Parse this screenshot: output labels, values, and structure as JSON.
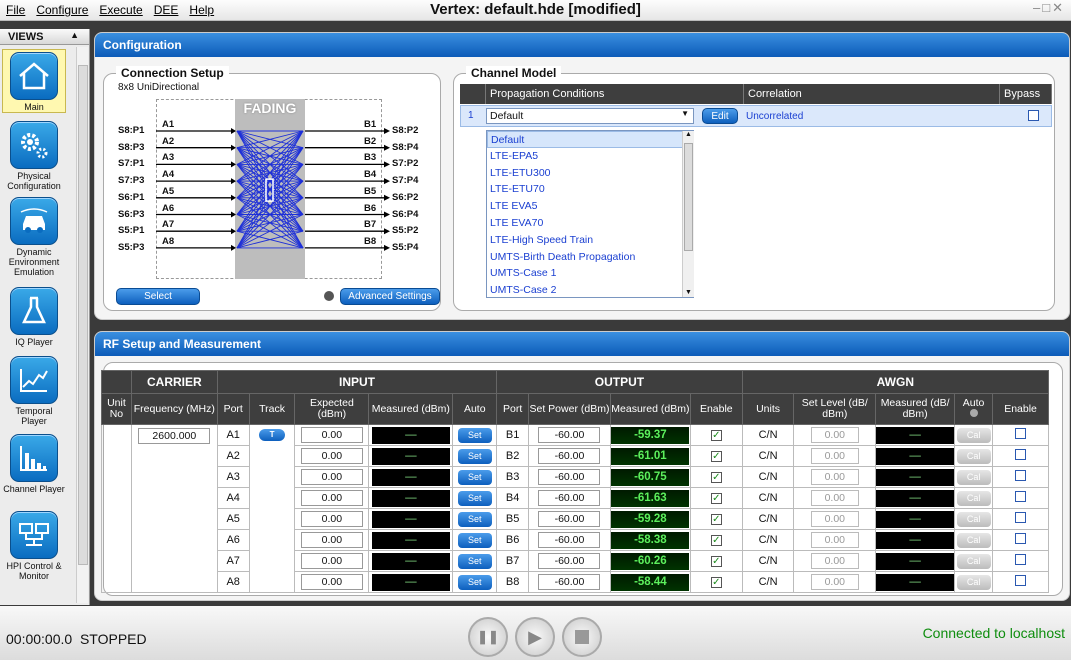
{
  "window": {
    "title": "Vertex: default.hde  [modified]",
    "menu": [
      "File",
      "Configure",
      "Execute",
      "DEE",
      "Help"
    ],
    "controls": "–□✕"
  },
  "sidebar": {
    "header": "VIEWS",
    "items": [
      {
        "label": "Main",
        "icon": "home-icon",
        "active": true
      },
      {
        "label": "Physical Configuration",
        "icon": "gears-icon"
      },
      {
        "label": "Dynamic Environment Emulation",
        "icon": "car-icon"
      },
      {
        "label": "IQ Player",
        "icon": "flask-icon"
      },
      {
        "label": "Temporal Player",
        "icon": "graph-icon"
      },
      {
        "label": "Channel Player",
        "icon": "bars-icon"
      },
      {
        "label": "HPI Control & Monitor",
        "icon": "network-icon"
      }
    ]
  },
  "configuration": {
    "title": "Configuration",
    "connection_setup": {
      "title": "Connection Setup",
      "mode": "8x8 UniDirectional",
      "fading_label": "FADING",
      "left_ports": [
        "S8:P1",
        "S8:P3",
        "S7:P1",
        "S7:P3",
        "S6:P1",
        "S6:P3",
        "S5:P1",
        "S5:P3"
      ],
      "inputs": [
        "A1",
        "A2",
        "A3",
        "A4",
        "A5",
        "A6",
        "A7",
        "A8"
      ],
      "outputs": [
        "B1",
        "B2",
        "B3",
        "B4",
        "B5",
        "B6",
        "B7",
        "B8"
      ],
      "right_ports": [
        "S8:P2",
        "S8:P4",
        "S7:P2",
        "S7:P4",
        "S6:P2",
        "S6:P4",
        "S5:P2",
        "S5:P4"
      ],
      "select_label": "Select",
      "advanced_label": "Advanced Settings"
    },
    "channel_model": {
      "title": "Channel Model",
      "headers": {
        "propagation": "Propagation Conditions",
        "correlation": "Correlation",
        "bypass": "Bypass"
      },
      "row": {
        "index": "1",
        "propagation": "Default",
        "edit_label": "Edit",
        "correlation": "Uncorrelated"
      },
      "dropdown_options": [
        "Default",
        "LTE-EPA5",
        "LTE-ETU300",
        "LTE-ETU70",
        "LTE EVA5",
        "LTE EVA70",
        "LTE-High Speed Train",
        "UMTS-Birth Death Propagation",
        "UMTS-Case 1",
        "UMTS-Case 2"
      ]
    }
  },
  "rf": {
    "title": "RF Setup and Measurement",
    "groups": {
      "carrier": "CARRIER",
      "input": "INPUT",
      "output": "OUTPUT",
      "awgn": "AWGN"
    },
    "headers": {
      "unit": "Unit No",
      "frequency": "Frequency (MHz)",
      "port": "Port",
      "track": "Track",
      "expected": "Expected (dBm)",
      "measured": "Measured (dBm)",
      "auto": "Auto",
      "set_power": "Set Power (dBm)",
      "enable": "Enable",
      "units": "Units",
      "set_level": "Set Level (dB/ dBm)",
      "measured_awgn": "Measured (dB/ dBm)"
    },
    "frequency": "2600.000",
    "track_label": "T",
    "set_label": "Set",
    "cal_label": "Cal",
    "rows": [
      {
        "in_port": "A1",
        "expected": "0.00",
        "in_meas": "—",
        "out_port": "B1",
        "set_power": "-60.00",
        "out_meas": "-59.37",
        "units": "C/N",
        "level": "0.00",
        "awgn_meas": "—"
      },
      {
        "in_port": "A2",
        "expected": "0.00",
        "in_meas": "—",
        "out_port": "B2",
        "set_power": "-60.00",
        "out_meas": "-61.01",
        "units": "C/N",
        "level": "0.00",
        "awgn_meas": "—"
      },
      {
        "in_port": "A3",
        "expected": "0.00",
        "in_meas": "—",
        "out_port": "B3",
        "set_power": "-60.00",
        "out_meas": "-60.75",
        "units": "C/N",
        "level": "0.00",
        "awgn_meas": "—"
      },
      {
        "in_port": "A4",
        "expected": "0.00",
        "in_meas": "—",
        "out_port": "B4",
        "set_power": "-60.00",
        "out_meas": "-61.63",
        "units": "C/N",
        "level": "0.00",
        "awgn_meas": "—"
      },
      {
        "in_port": "A5",
        "expected": "0.00",
        "in_meas": "—",
        "out_port": "B5",
        "set_power": "-60.00",
        "out_meas": "-59.28",
        "units": "C/N",
        "level": "0.00",
        "awgn_meas": "—"
      },
      {
        "in_port": "A6",
        "expected": "0.00",
        "in_meas": "—",
        "out_port": "B6",
        "set_power": "-60.00",
        "out_meas": "-58.38",
        "units": "C/N",
        "level": "0.00",
        "awgn_meas": "—"
      },
      {
        "in_port": "A7",
        "expected": "0.00",
        "in_meas": "—",
        "out_port": "B7",
        "set_power": "-60.00",
        "out_meas": "-60.26",
        "units": "C/N",
        "level": "0.00",
        "awgn_meas": "—"
      },
      {
        "in_port": "A8",
        "expected": "0.00",
        "in_meas": "—",
        "out_port": "B8",
        "set_power": "-60.00",
        "out_meas": "-58.44",
        "units": "C/N",
        "level": "0.00",
        "awgn_meas": "—"
      }
    ]
  },
  "status": {
    "time": "00:00:00.0",
    "state": "STOPPED",
    "connection": "Connected to localhost"
  },
  "colors": {
    "accent": "#0c5bb8",
    "connected": "#0e8d0e",
    "measured_text": "#5cf05c"
  }
}
